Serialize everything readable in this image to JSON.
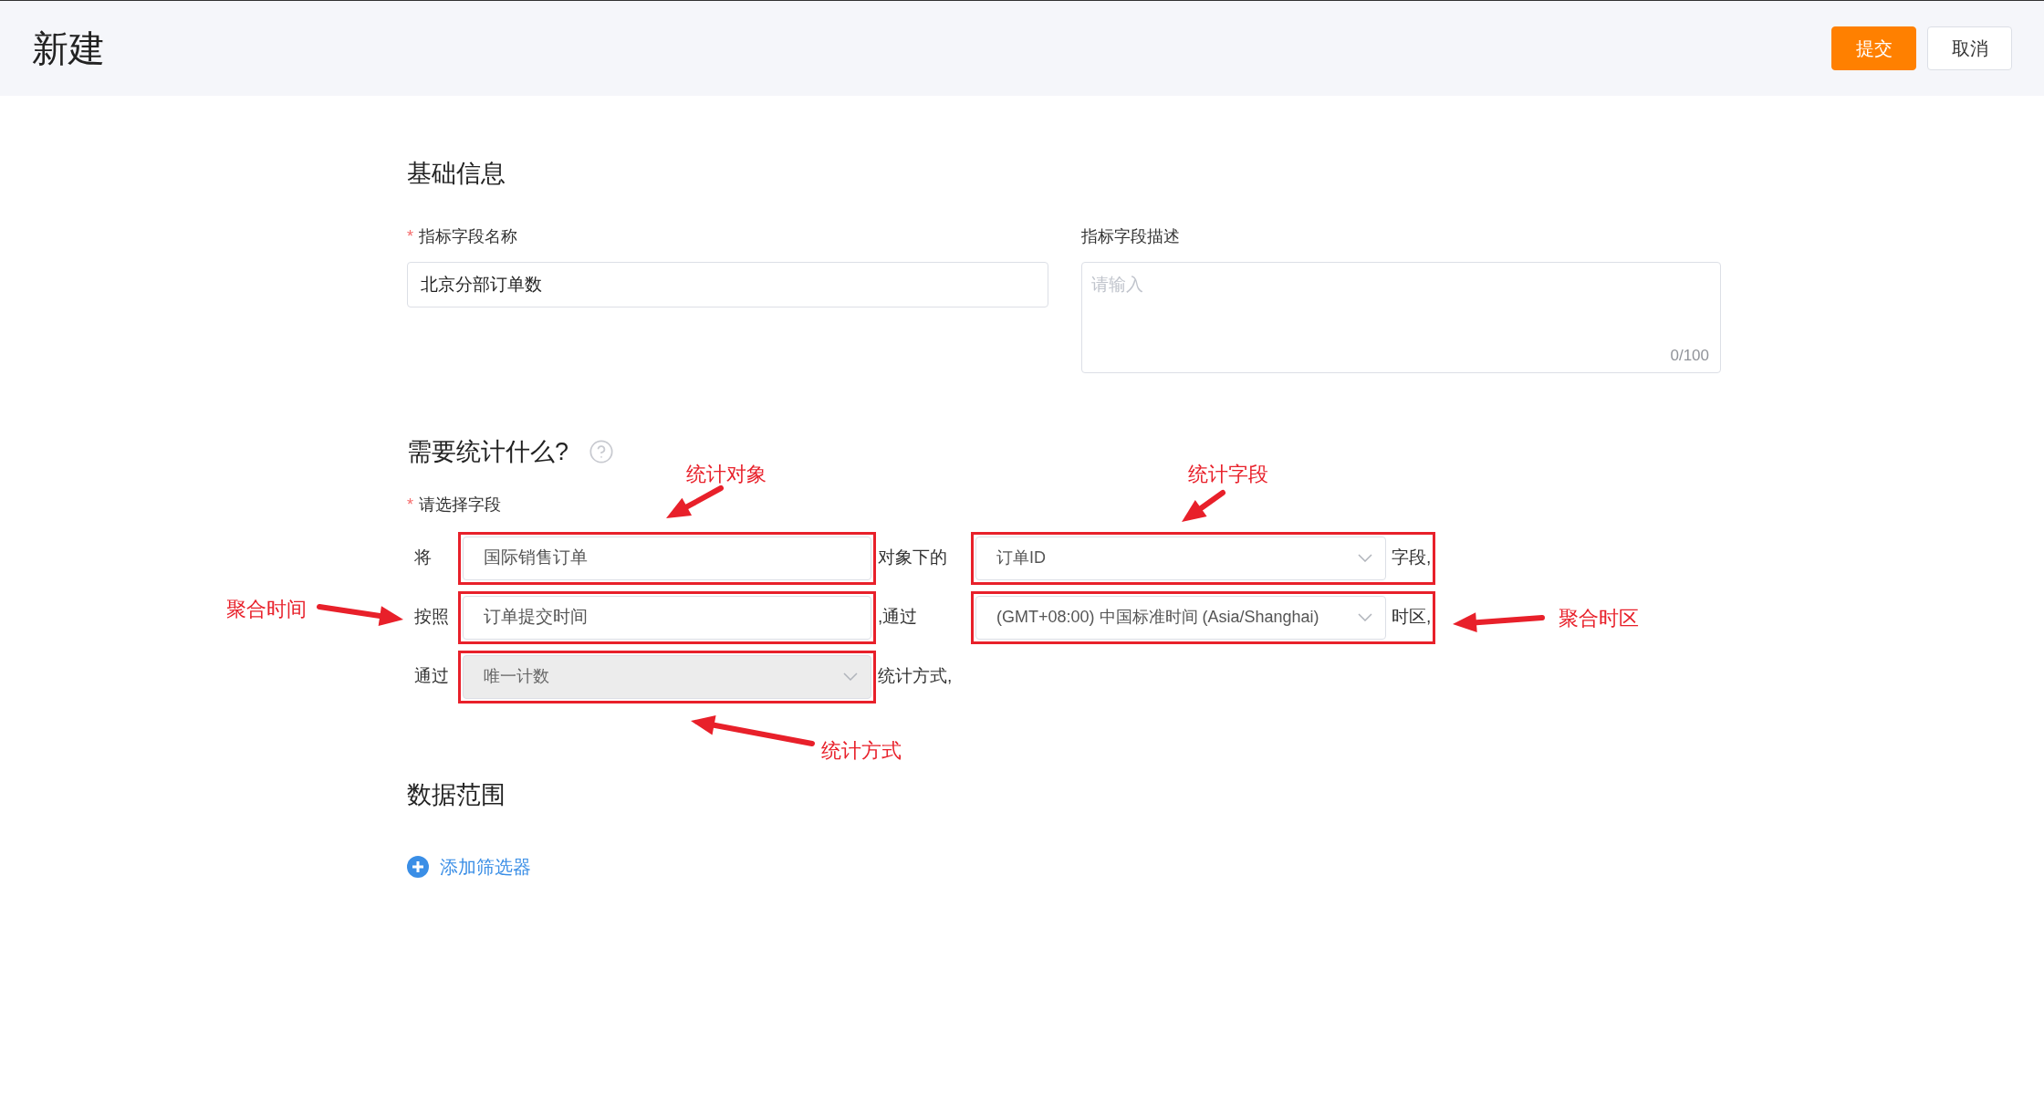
{
  "header": {
    "title": "新建",
    "buttons": [
      {
        "label": "提交",
        "kind": "primary"
      },
      {
        "label": "取消",
        "kind": "default"
      }
    ]
  },
  "basic_info": {
    "heading": "基础信息",
    "name_field": {
      "label": "指标字段名称",
      "required_mark": "*",
      "value": "北京分部订单数"
    },
    "description_field": {
      "label": "指标字段描述",
      "placeholder": "请输入",
      "counter": "0/100"
    }
  },
  "statistics": {
    "heading": "需要统计什么?",
    "field_label": "请选择字段",
    "required_mark": "*",
    "rows": [
      {
        "prefix": "将",
        "control": {
          "kind": "input",
          "value": "国际销售订单",
          "disabled": false
        },
        "connector": "对象下的",
        "second_control": {
          "kind": "select",
          "value": "订单ID",
          "disabled": false
        },
        "suffix": "字段,"
      },
      {
        "prefix": "按照",
        "control": {
          "kind": "input",
          "value": "订单提交时间",
          "disabled": false
        },
        "connector": ",通过",
        "second_control": {
          "kind": "select",
          "value": "(GMT+08:00) 中国标准时间 (Asia/Shanghai)",
          "disabled": false
        },
        "suffix": "时区,"
      },
      {
        "prefix": "通过",
        "control": {
          "kind": "select",
          "value": "唯一计数",
          "disabled": true
        },
        "connector": "统计方式,"
      }
    ]
  },
  "data_range": {
    "heading": "数据范围",
    "add_filter": "添加筛选器"
  },
  "annotations": [
    "统计对象",
    "统计字段",
    "聚合时间",
    "聚合时区",
    "统计方式"
  ]
}
